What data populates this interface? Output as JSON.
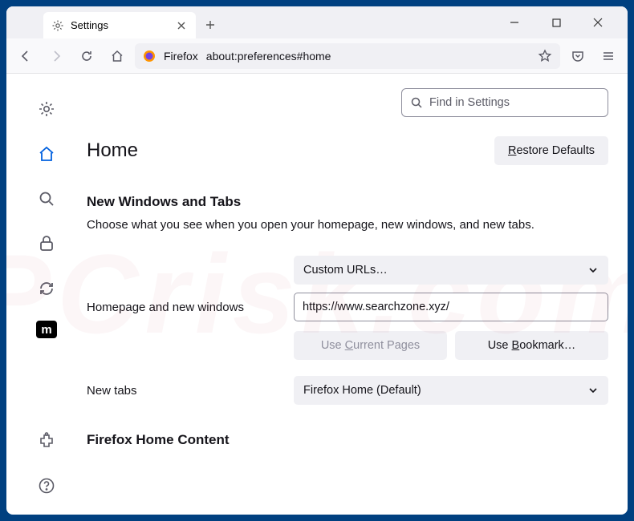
{
  "tab": {
    "title": "Settings"
  },
  "urlbar": {
    "brand": "Firefox",
    "address": "about:preferences#home"
  },
  "search": {
    "placeholder": "Find in Settings"
  },
  "page": {
    "title": "Home",
    "restore": "Restore Defaults",
    "section1": {
      "heading": "New Windows and Tabs",
      "desc": "Choose what you see when you open your homepage, new windows, and new tabs."
    },
    "homepage": {
      "label": "Homepage and new windows",
      "select": "Custom URLs…",
      "url": "https://www.searchzone.xyz/",
      "useCurrent": "Use Current Pages",
      "useBookmark": "Use Bookmark…"
    },
    "newtabs": {
      "label": "New tabs",
      "select": "Firefox Home (Default)"
    },
    "section3": {
      "heading": "Firefox Home Content"
    }
  },
  "sidebar": {
    "metro": "m"
  }
}
